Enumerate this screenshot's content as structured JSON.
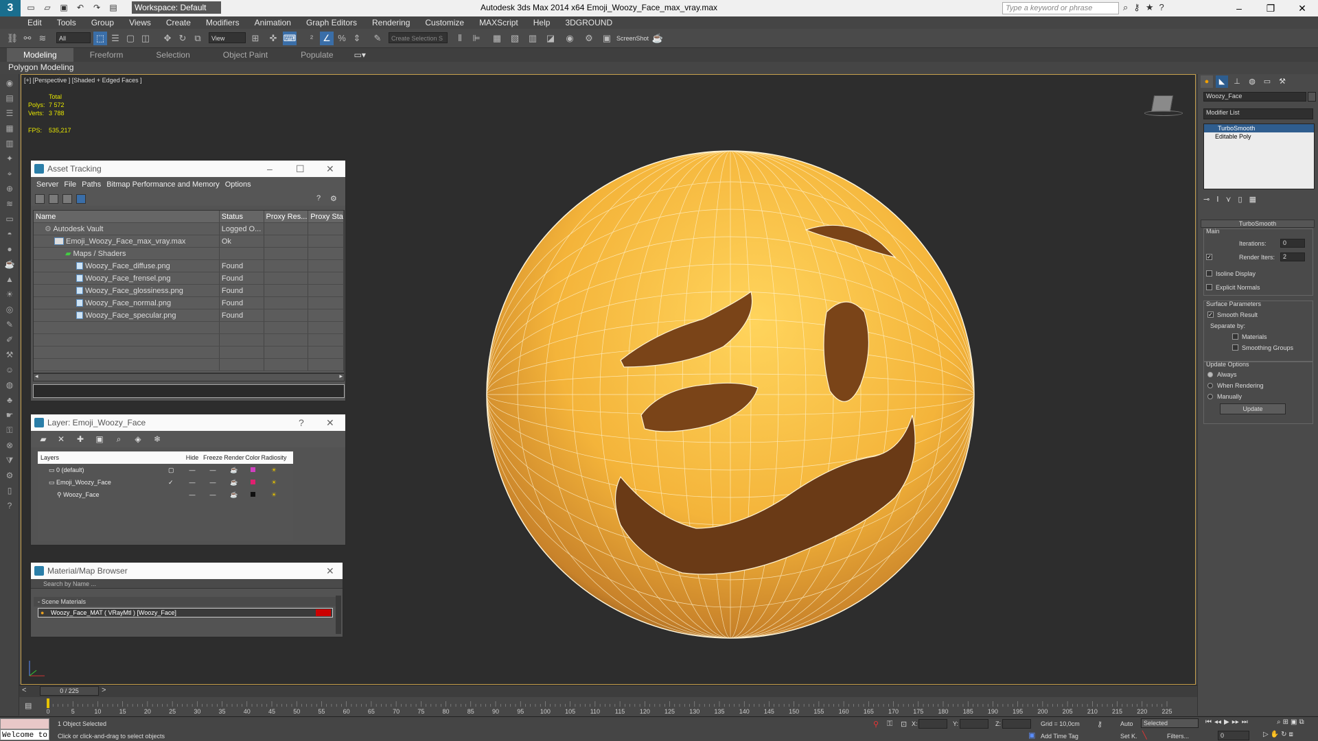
{
  "titlebar": {
    "workspace": "Workspace: Default",
    "app_title": "Autodesk 3ds Max  2014 x64     Emoji_Woozy_Face_max_vray.max",
    "search_placeholder": "Type a keyword or phrase"
  },
  "menu": [
    "Edit",
    "Tools",
    "Group",
    "Views",
    "Create",
    "Modifiers",
    "Animation",
    "Graph Editors",
    "Rendering",
    "Customize",
    "MAXScript",
    "Help",
    "3DGROUND"
  ],
  "toolbar": {
    "filter_all": "All",
    "ref_coord": "View",
    "selection_set": "Create Selection S",
    "screenshot_label": "ScreenShot"
  },
  "ribbon": {
    "tabs": [
      "Modeling",
      "Freeform",
      "Selection",
      "Object Paint",
      "Populate"
    ],
    "active_tab": "Modeling",
    "subpanel": "Polygon Modeling"
  },
  "viewport": {
    "label": "[+] [Perspective ] [Shaded + Edged Faces ]",
    "stats_total": "Total",
    "polys_label": "Polys:",
    "polys_value": "7 572",
    "verts_label": "Verts:",
    "verts_value": "3 788",
    "fps_label": "FPS:",
    "fps_value": "535,217"
  },
  "asset_tracking": {
    "title": "Asset Tracking",
    "menu": [
      "Server",
      "File",
      "Paths",
      "Bitmap Performance and Memory",
      "Options"
    ],
    "columns": [
      "Name",
      "Status",
      "Proxy Res...",
      "Proxy Sta"
    ],
    "rows": [
      {
        "name": "Autodesk Vault",
        "status": "Logged O...",
        "indent": 0
      },
      {
        "name": "Emoji_Woozy_Face_max_vray.max",
        "status": "Ok",
        "indent": 1
      },
      {
        "name": "Maps / Shaders",
        "status": "",
        "indent": 2
      },
      {
        "name": "Woozy_Face_diffuse.png",
        "status": "Found",
        "indent": 3
      },
      {
        "name": "Woozy_Face_frensel.png",
        "status": "Found",
        "indent": 3
      },
      {
        "name": "Woozy_Face_glossiness.png",
        "status": "Found",
        "indent": 3
      },
      {
        "name": "Woozy_Face_normal.png",
        "status": "Found",
        "indent": 3
      },
      {
        "name": "Woozy_Face_specular.png",
        "status": "Found",
        "indent": 3
      }
    ]
  },
  "layer_window": {
    "title": "Layer: Emoji_Woozy_Face",
    "question": "?",
    "columns": [
      "Layers",
      "Hide",
      "Freeze",
      "Render",
      "Color",
      "Radiosity"
    ],
    "rows": [
      {
        "name": "0 (default)",
        "color": "#d040c0"
      },
      {
        "name": "Emoji_Woozy_Face",
        "color": "#e02070"
      },
      {
        "name": "Woozy_Face",
        "color": "#101010"
      }
    ]
  },
  "material_browser": {
    "title": "Material/Map Browser",
    "search_placeholder": "Search by Name ...",
    "section": "- Scene Materials",
    "item": "Woozy_Face_MAT ( VRayMtl ) [Woozy_Face]"
  },
  "command_panel": {
    "object_name": "Woozy_Face",
    "modifier_list": "Modifier List",
    "stack": [
      "TurboSmooth",
      "Editable Poly"
    ],
    "rollout_title": "TurboSmooth",
    "main_label": "Main",
    "iterations_label": "Iterations:",
    "iterations_value": "0",
    "render_iters_label": "Render Iters:",
    "render_iters_value": "2",
    "isoline_label": "Isoline Display",
    "explicit_label": "Explicit Normals",
    "surface_label": "Surface Parameters",
    "smooth_label": "Smooth Result",
    "separate_label": "Separate by:",
    "materials_label": "Materials",
    "smoothing_label": "Smoothing Groups",
    "update_options_label": "Update Options",
    "always_label": "Always",
    "when_rendering_label": "When Rendering",
    "manually_label": "Manually",
    "update_button": "Update"
  },
  "timeline": {
    "frame": "0 / 225",
    "ticks": [
      "0",
      "5",
      "10",
      "15",
      "20",
      "25",
      "30",
      "35",
      "40",
      "45",
      "50",
      "55",
      "60",
      "65",
      "70",
      "75",
      "80",
      "85",
      "90",
      "95",
      "100",
      "105",
      "110",
      "115",
      "120",
      "125",
      "130",
      "135",
      "140",
      "145",
      "150",
      "155",
      "160",
      "165",
      "170",
      "175",
      "180",
      "185",
      "190",
      "195",
      "200",
      "205",
      "210",
      "215",
      "220",
      "225"
    ]
  },
  "status": {
    "listener": "Welcome to",
    "selected": "1 Object Selected",
    "prompt": "Click or click-and-drag to select objects",
    "x_label": "X:",
    "y_label": "Y:",
    "z_label": "Z:",
    "grid": "Grid = 10,0cm",
    "add_time_tag": "Add Time Tag",
    "auto": "Auto",
    "selected_dropdown": "Selected",
    "setk": "Set K.",
    "filters": "Filters...",
    "frame_value": "0"
  }
}
